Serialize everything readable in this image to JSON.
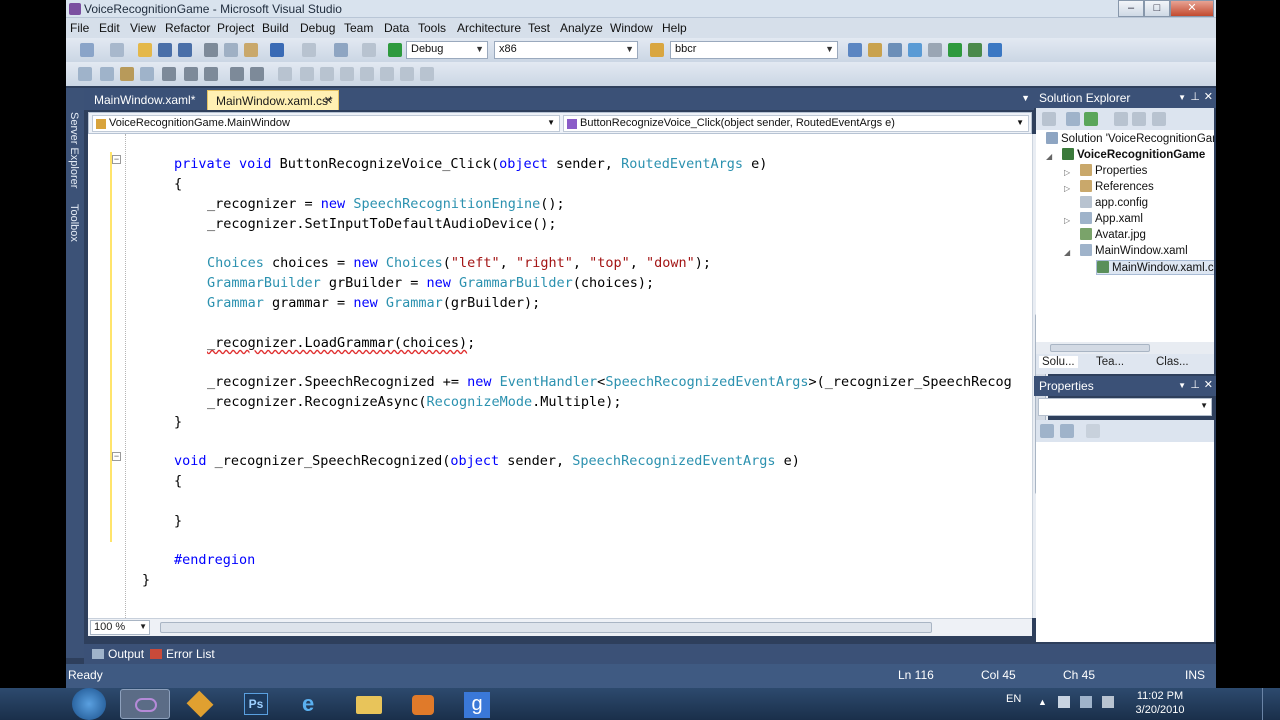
{
  "window": {
    "title": "VoiceRecognitionGame - Microsoft Visual Studio"
  },
  "menu": [
    "File",
    "Edit",
    "View",
    "Refactor",
    "Project",
    "Build",
    "Debug",
    "Team",
    "Data",
    "Tools",
    "Architecture",
    "Test",
    "Analyze",
    "Window",
    "Help"
  ],
  "toolbar": {
    "config": "Debug",
    "platform": "x86",
    "find": "bbcr"
  },
  "left_strip": {
    "server_explorer": "Server Explorer",
    "toolbox": "Toolbox"
  },
  "tabs": [
    {
      "label": "MainWindow.xaml*"
    },
    {
      "label": "MainWindow.xaml.cs*",
      "close": "✕"
    }
  ],
  "nav": {
    "type": "VoiceRecognitionGame.MainWindow",
    "member": "ButtonRecognizeVoice_Click(object sender, RoutedEventArgs e)"
  },
  "code": {
    "l1": {
      "a": "private void ",
      "b": "ButtonRecognizeVoice_Click(",
      "c": "object",
      "d": " sender, ",
      "e": "RoutedEventArgs",
      "f": " e)"
    },
    "l2": "{",
    "l3": {
      "a": "_recognizer = ",
      "b": "new",
      "c": " ",
      "d": "SpeechRecognitionEngine",
      "e": "();"
    },
    "l4": "_recognizer.SetInputToDefaultAudioDevice();",
    "l5": {
      "a": "Choices",
      "b": " choices = ",
      "c": "new",
      "d": " ",
      "e": "Choices",
      "f": "(",
      "g": "\"left\"",
      "h": ", ",
      "i": "\"right\"",
      "j": ", ",
      "k": "\"top\"",
      "l": ", ",
      "m": "\"down\"",
      "n": ");"
    },
    "l6": {
      "a": "GrammarBuilder",
      "b": " grBuilder = ",
      "c": "new",
      "d": " ",
      "e": "GrammarBuilder",
      "f": "(choices);"
    },
    "l7": {
      "a": "Grammar",
      "b": " grammar = ",
      "c": "new",
      "d": " ",
      "e": "Grammar",
      "f": "(grBuilder);"
    },
    "l8": {
      "a": "_recognizer.LoadGrammar(choices)",
      "b": ";"
    },
    "l9": {
      "a": "_recognizer.SpeechRecognized += ",
      "b": "new",
      "c": " ",
      "d": "EventHandler",
      "e": "<",
      "f": "SpeechRecognizedEventArgs",
      "g": ">(_recognizer_SpeechRecog"
    },
    "l10": {
      "a": "_recognizer.RecognizeAsync(",
      "b": "RecognizeMode",
      "c": ".Multiple);"
    },
    "l11": "}",
    "l12": {
      "a": "void",
      "b": " _recognizer_SpeechRecognized(",
      "c": "object",
      "d": " sender, ",
      "e": "SpeechRecognizedEventArgs",
      "f": " e)"
    },
    "l13": "{",
    "l14": "}",
    "l15": "#endregion",
    "l16": "}",
    "l17": "}"
  },
  "zoom": "100 %",
  "bottom_tabs": {
    "output": "Output",
    "errors": "Error List"
  },
  "status": {
    "ready": "Ready",
    "ln": "Ln 116",
    "col": "Col 45",
    "ch": "Ch 45",
    "ins": "INS"
  },
  "solution_explorer": {
    "title": "Solution Explorer",
    "items": [
      "Solution 'VoiceRecognitionGame'",
      "VoiceRecognitionGame",
      "Properties",
      "References",
      "app.config",
      "App.xaml",
      "Avatar.jpg",
      "MainWindow.xaml",
      "MainWindow.xaml.cs"
    ],
    "tabs": [
      "Solu...",
      "Tea...",
      "Clas..."
    ]
  },
  "properties": {
    "title": "Properties"
  },
  "taskbar": {
    "lang": "EN",
    "time": "11:02 PM",
    "date": "3/20/2010"
  },
  "colors": {
    "keyword": "#0000ff",
    "type": "#2b91af",
    "string": "#a31515",
    "frame": "#2e3f5c"
  }
}
